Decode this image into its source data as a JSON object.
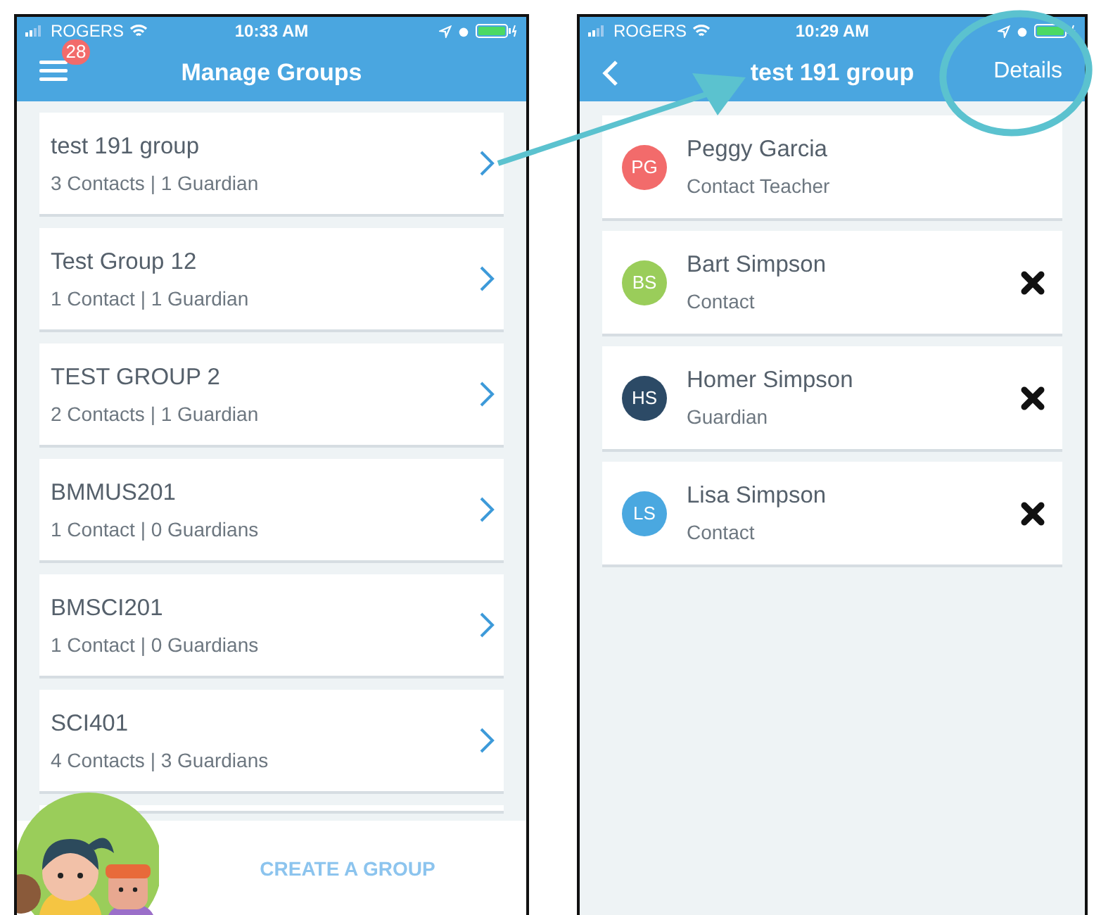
{
  "left_screen": {
    "status_bar": {
      "carrier": "ROGERS",
      "time": "10:33 AM"
    },
    "header": {
      "title": "Manage Groups",
      "badge": "28"
    },
    "groups": [
      {
        "name": "test 191 group",
        "summary": "3 Contacts | 1 Guardian"
      },
      {
        "name": "Test Group 12",
        "summary": "1 Contact | 1 Guardian"
      },
      {
        "name": "TEST GROUP 2",
        "summary": "2 Contacts | 1 Guardian"
      },
      {
        "name": "BMMUS201",
        "summary": "1 Contact | 0 Guardians"
      },
      {
        "name": "BMSCI201",
        "summary": "1 Contact | 0 Guardians"
      },
      {
        "name": "SCI401",
        "summary": "4 Contacts | 3 Guardians"
      }
    ],
    "footer": {
      "button": "CREATE A GROUP"
    }
  },
  "right_screen": {
    "status_bar": {
      "carrier": "ROGERS",
      "time": "10:29 AM"
    },
    "header": {
      "title": "test 191 group",
      "action": "Details"
    },
    "members": [
      {
        "initials": "PG",
        "name": "Peggy Garcia",
        "role": "Contact  Teacher",
        "color": "#f26b6b",
        "removable": false
      },
      {
        "initials": "BS",
        "name": "Bart Simpson",
        "role": "Contact",
        "color": "#9acd5a",
        "removable": true
      },
      {
        "initials": "HS",
        "name": "Homer Simpson",
        "role": "Guardian",
        "color": "#2c4a66",
        "removable": true
      },
      {
        "initials": "LS",
        "name": "Lisa Simpson",
        "role": "Contact",
        "color": "#4aa8e0",
        "removable": true
      }
    ]
  }
}
